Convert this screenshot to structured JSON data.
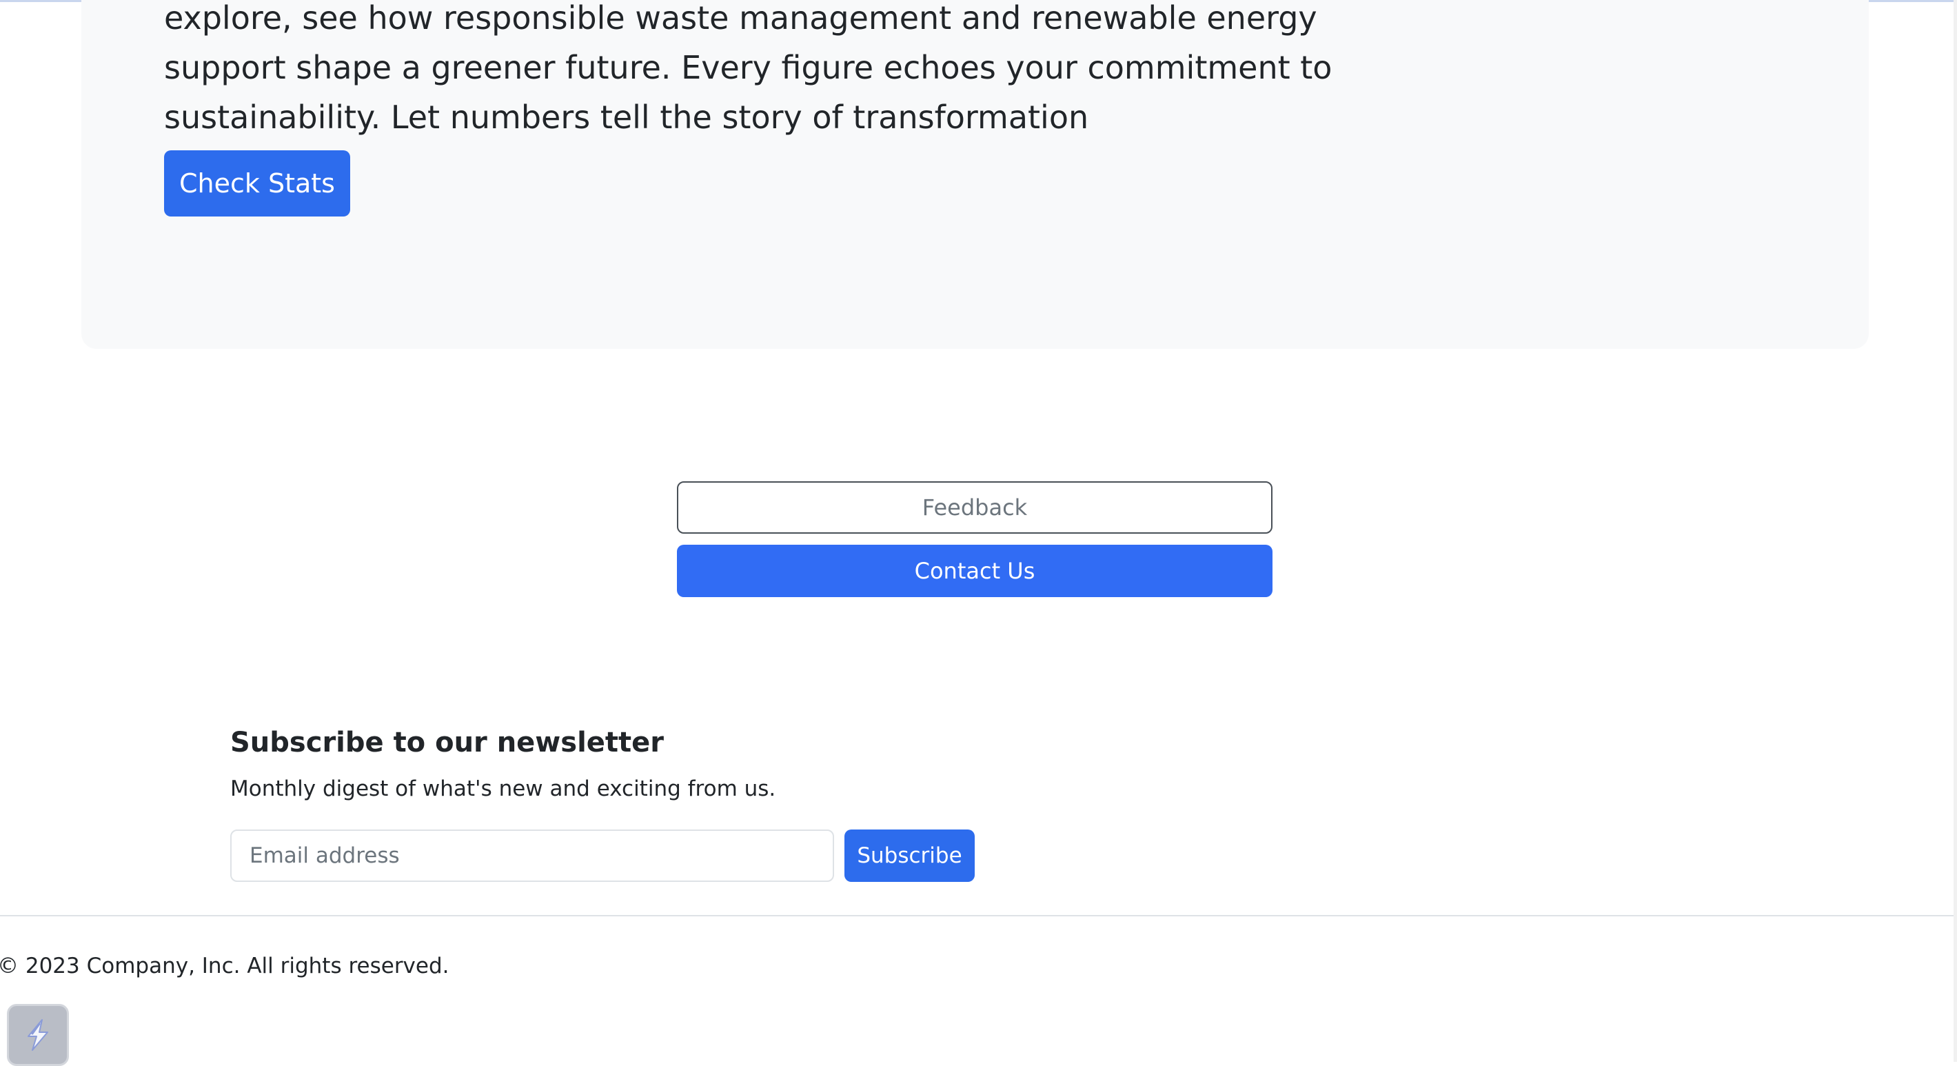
{
  "hero": {
    "description": "explore, see how responsible waste management and renewable energy support shape a greener future. Every figure echoes your commitment to sustainability. Let numbers tell the story of transformation",
    "button_label": "Check Stats"
  },
  "contact": {
    "feedback_placeholder": "Feedback",
    "button_label": "Contact Us"
  },
  "newsletter": {
    "title": "Subscribe to our newsletter",
    "description": "Monthly digest of what's new and exciting from us.",
    "email_placeholder": "Email address",
    "button_label": "Subscribe"
  },
  "footer": {
    "copyright": "© 2023 Company, Inc. All rights reserved."
  },
  "widget": {
    "icon": "lightning-bolt-icon"
  },
  "colors": {
    "primary": "#2d6ced",
    "hero_background": "#f8f9fa"
  }
}
